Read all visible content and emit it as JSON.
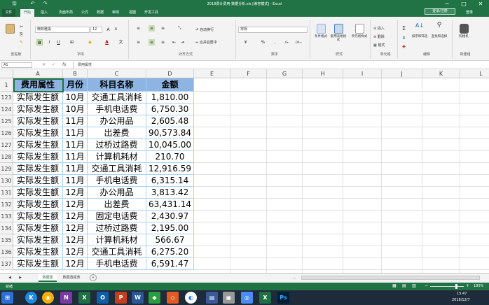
{
  "window": {
    "title": "2018费计费用-数据分析.xls [兼容模式] - Excel",
    "minimize": "─",
    "maximize": "□",
    "close": "✕"
  },
  "quick_access": {
    "save": "🖫",
    "undo": "↶",
    "redo": "↷"
  },
  "tabs": [
    "文件",
    "开始",
    "插入",
    "页面布局",
    "公式",
    "数据",
    "审阅",
    "视图",
    "开发工具"
  ],
  "account": {
    "login_label": "登录/注册",
    "user": "登录"
  },
  "ribbon": {
    "font_name": "微软雅黑",
    "font_size": "12",
    "number_format": "常规",
    "wrap_text": "自动换行",
    "merge_center": "合并后居中",
    "insert": "插入",
    "delete": "删除",
    "format": "格式",
    "sort_filter": "排序和筛选",
    "find_select": "查找和选择",
    "screenshot": "照相机",
    "cond_format": "条件格式",
    "table_format": "套用表格格式",
    "cell_style": "单元格样式",
    "groups": {
      "clipboard": "剪贴板",
      "font": "字体",
      "alignment": "对齐方式",
      "number": "数字",
      "styles": "样式",
      "cells": "单元格",
      "editing": "编辑",
      "new_group": "新建组"
    }
  },
  "formula_bar": {
    "name_box": "A1",
    "fx": "fx",
    "content": "费用属性"
  },
  "columns": [
    "A",
    "B",
    "C",
    "D",
    "E",
    "F",
    "G",
    "H",
    "I",
    "J",
    "K",
    "L"
  ],
  "table_header": {
    "row": "1",
    "cells": [
      "费用属性",
      "月份",
      "科目名称",
      "金额"
    ]
  },
  "rows": [
    {
      "row": "123",
      "cells": [
        "实际发生额",
        "10月",
        "交通工具消耗",
        "1,810.00"
      ]
    },
    {
      "row": "124",
      "cells": [
        "实际发生额",
        "10月",
        "手机电话费",
        "6,750.30"
      ]
    },
    {
      "row": "125",
      "cells": [
        "实际发生额",
        "11月",
        "办公用品",
        "2,605.48"
      ]
    },
    {
      "row": "126",
      "cells": [
        "实际发生额",
        "11月",
        "出差费",
        "90,573.84"
      ]
    },
    {
      "row": "127",
      "cells": [
        "实际发生额",
        "11月",
        "过桥过路费",
        "10,045.00"
      ]
    },
    {
      "row": "128",
      "cells": [
        "实际发生额",
        "11月",
        "计算机耗材",
        "210.70"
      ]
    },
    {
      "row": "129",
      "cells": [
        "实际发生额",
        "11月",
        "交通工具消耗",
        "12,916.59"
      ]
    },
    {
      "row": "130",
      "cells": [
        "实际发生额",
        "11月",
        "手机电话费",
        "6,315.14"
      ]
    },
    {
      "row": "131",
      "cells": [
        "实际发生额",
        "12月",
        "办公用品",
        "3,813.42"
      ]
    },
    {
      "row": "132",
      "cells": [
        "实际发生额",
        "12月",
        "出差费",
        "63,431.14"
      ]
    },
    {
      "row": "133",
      "cells": [
        "实际发生额",
        "12月",
        "固定电话费",
        "2,430.97"
      ]
    },
    {
      "row": "134",
      "cells": [
        "实际发生额",
        "12月",
        "过桥过路费",
        "2,195.00"
      ]
    },
    {
      "row": "135",
      "cells": [
        "实际发生额",
        "12月",
        "计算机耗材",
        "566.67"
      ]
    },
    {
      "row": "136",
      "cells": [
        "实际发生额",
        "12月",
        "交通工具消耗",
        "6,275.20"
      ]
    },
    {
      "row": "137",
      "cells": [
        "实际发生额",
        "12月",
        "手机电话费",
        "6,591.47"
      ]
    }
  ],
  "sheet_tabs": [
    "数据源",
    "数据透视表"
  ],
  "sheet_nav": {
    "prev": "◀",
    "next": "▶",
    "add": "+",
    "ellipsis": "..."
  },
  "status": {
    "ready": "就绪",
    "zoom": "180%",
    "zoom_minus": "−",
    "zoom_plus": "+"
  },
  "taskbar": {
    "time": "15:47",
    "date": "2018/12/7"
  },
  "colors": {
    "excel_green": "#217346",
    "header_fill": "#8db4e2",
    "grid_border": "#aad2f0"
  }
}
